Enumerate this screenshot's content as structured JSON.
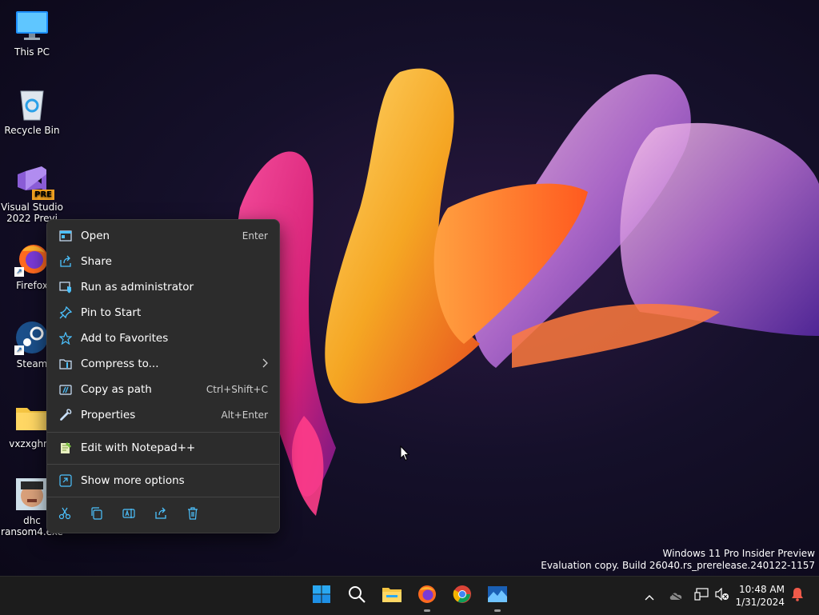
{
  "desktop": {
    "icons": [
      {
        "label": "This PC",
        "icon": "monitor-icon"
      },
      {
        "label": "Recycle Bin",
        "icon": "recycle-bin-icon"
      },
      {
        "label_line1": "Visual Studio",
        "label_line2": "2022 Previ",
        "badge": "PRE",
        "icon": "visual-studio-icon"
      },
      {
        "label": "Firefox",
        "icon": "firefox-icon"
      },
      {
        "label": "Steam",
        "icon": "steam-icon"
      },
      {
        "label": "vxzxghnv",
        "icon": "folder-icon"
      },
      {
        "label_line1": "dhc",
        "label_line2": "ransom4.exe",
        "icon": "app-photo-icon"
      }
    ]
  },
  "context_menu": {
    "items": [
      {
        "label": "Open",
        "shortcut": "Enter",
        "icon": "open-icon"
      },
      {
        "label": "Share",
        "shortcut": "",
        "icon": "share-icon"
      },
      {
        "label": "Run as administrator",
        "shortcut": "",
        "icon": "shield-icon"
      },
      {
        "label": "Pin to Start",
        "shortcut": "",
        "icon": "pin-icon"
      },
      {
        "label": "Add to Favorites",
        "shortcut": "",
        "icon": "star-icon"
      },
      {
        "label": "Compress to...",
        "shortcut": "",
        "icon": "zip-folder-icon",
        "submenu": true
      },
      {
        "label": "Copy as path",
        "shortcut": "Ctrl+Shift+C",
        "icon": "copy-path-icon"
      },
      {
        "label": "Properties",
        "shortcut": "Alt+Enter",
        "icon": "wrench-icon"
      },
      {
        "label": "Edit with Notepad++",
        "shortcut": "",
        "icon": "notepadpp-icon"
      },
      {
        "label": "Show more options",
        "shortcut": "",
        "icon": "more-options-icon"
      }
    ],
    "actions": [
      "cut-icon",
      "copy-icon",
      "rename-icon",
      "share-icon",
      "delete-icon"
    ]
  },
  "watermark": {
    "line1": "Windows 11 Pro Insider Preview",
    "line2": "Evaluation copy. Build 26040.rs_prerelease.240122-1157"
  },
  "taskbar": {
    "apps": [
      "start-icon",
      "search-icon",
      "file-explorer-icon",
      "firefox-icon",
      "chrome-icon",
      "photos-app-icon"
    ],
    "time": "10:48 AM",
    "date": "1/31/2024"
  },
  "colors": {
    "menu_bg": "#2c2c2c",
    "accent_blue": "#4cc2ff",
    "taskbar_bg": "#1c1c1c"
  }
}
